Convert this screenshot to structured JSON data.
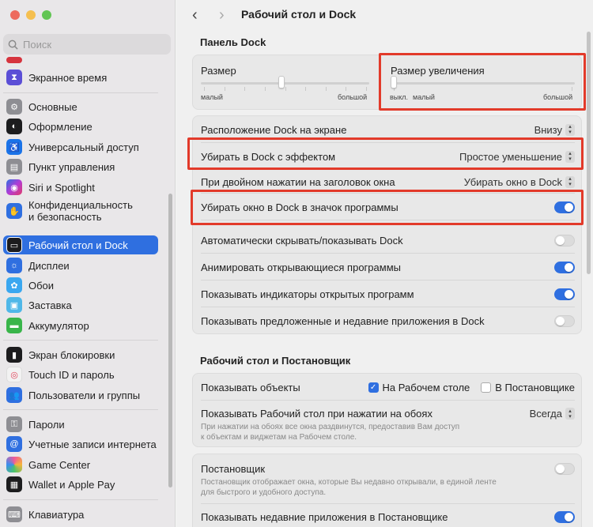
{
  "window": {
    "title": "Рабочий стол и Dock",
    "traffic": {
      "close": "#ed6a5e",
      "minimize": "#f5bf4f",
      "zoom": "#62c554"
    }
  },
  "search": {
    "placeholder": "Поиск"
  },
  "sidebar": {
    "items": [
      {
        "label": "Экранное время",
        "icon": "hourglass-icon",
        "color": "#5b4ed6"
      },
      {
        "label": "Основные",
        "icon": "gear-icon",
        "color": "#8e8e93"
      },
      {
        "label": "Оформление",
        "icon": "appearance-icon",
        "color": "#1c1c1e"
      },
      {
        "label": "Универсальный доступ",
        "icon": "accessibility-icon",
        "color": "#1a73e8"
      },
      {
        "label": "Пункт управления",
        "icon": "control-center-icon",
        "color": "#8e8e93"
      },
      {
        "label": "Siri и Spotlight",
        "icon": "siri-icon",
        "color": "#9b3bd6"
      },
      {
        "label": "Конфиденциальность\nи безопасность",
        "icon": "hand-icon",
        "color": "#2f6fe0"
      },
      {
        "label": "Рабочий стол и Dock",
        "icon": "dock-icon",
        "color": "#1c1c1e"
      },
      {
        "label": "Дисплеи",
        "icon": "display-icon",
        "color": "#2f6fe0"
      },
      {
        "label": "Обои",
        "icon": "wallpaper-icon",
        "color": "#3aa7f0"
      },
      {
        "label": "Заставка",
        "icon": "screensaver-icon",
        "color": "#4fb7e8"
      },
      {
        "label": "Аккумулятор",
        "icon": "battery-icon",
        "color": "#39b54a"
      },
      {
        "label": "Экран блокировки",
        "icon": "lock-screen-icon",
        "color": "#1c1c1e"
      },
      {
        "label": "Touch ID и пароль",
        "icon": "fingerprint-icon",
        "color": "#f2f2f2"
      },
      {
        "label": "Пользователи и группы",
        "icon": "users-icon",
        "color": "#2f6fe0"
      },
      {
        "label": "Пароли",
        "icon": "key-icon",
        "color": "#8e8e93"
      },
      {
        "label": "Учетные записи интернета",
        "icon": "at-icon",
        "color": "#2f6fe0"
      },
      {
        "label": "Game Center",
        "icon": "game-center-icon",
        "color": "#f2f2f2"
      },
      {
        "label": "Wallet и Apple Pay",
        "icon": "wallet-icon",
        "color": "#1c1c1e"
      },
      {
        "label": "Клавиатура",
        "icon": "keyboard-icon",
        "color": "#8e8e93"
      }
    ],
    "active_index": 7
  },
  "dock_panel": {
    "title": "Панель Dock",
    "size": {
      "label": "Размер",
      "min": "малый",
      "max": "большой",
      "value": 0.48
    },
    "magnification": {
      "label": "Размер увеличения",
      "off": "выкл.",
      "min": "малый",
      "max": "большой",
      "value": 0.0
    },
    "position": {
      "label": "Расположение Dock на экране",
      "value": "Внизу"
    },
    "minimize_effect": {
      "label": "Убирать в Dock с эффектом",
      "value": "Простое уменьшение"
    },
    "double_click": {
      "label": "При двойном нажатии на заголовок окна",
      "value": "Убирать окно в Dock"
    },
    "minimize_to_app": {
      "label": "Убирать окно в Dock в значок программы",
      "on": true
    },
    "autohide": {
      "label": "Автоматически скрывать/показывать Dock",
      "on": false
    },
    "animate": {
      "label": "Анимировать открывающиеся программы",
      "on": true
    },
    "indicators": {
      "label": "Показывать индикаторы открытых программ",
      "on": true
    },
    "recent": {
      "label": "Показывать предложенные и недавние приложения в Dock",
      "on": false
    }
  },
  "desktop": {
    "title": "Рабочий стол и Постановщик",
    "show_items": {
      "label": "Показывать объекты",
      "desktop": "На Рабочем столе",
      "desktop_on": true,
      "stage": "В Постановщике",
      "stage_on": false
    },
    "click_wallpaper": {
      "label": "Показывать Рабочий стол при нажатии на обоях",
      "value": "Всегда",
      "desc1": "При нажатии на обоях все окна раздвинутся, предоставив Вам доступ",
      "desc2": "к объектам и виджетам на Рабочем столе."
    },
    "stage_manager": {
      "label": "Постановщик",
      "on": false,
      "desc1": "Постановщик отображает окна, которые Вы недавно открывали, в единой ленте",
      "desc2": "для быстрого и удобного доступа."
    },
    "recent_stage": {
      "label": "Показывать недавние приложения в Постановщике",
      "on": true
    }
  },
  "highlight_color": "#e23a2a",
  "accent_color": "#2f6fe0"
}
